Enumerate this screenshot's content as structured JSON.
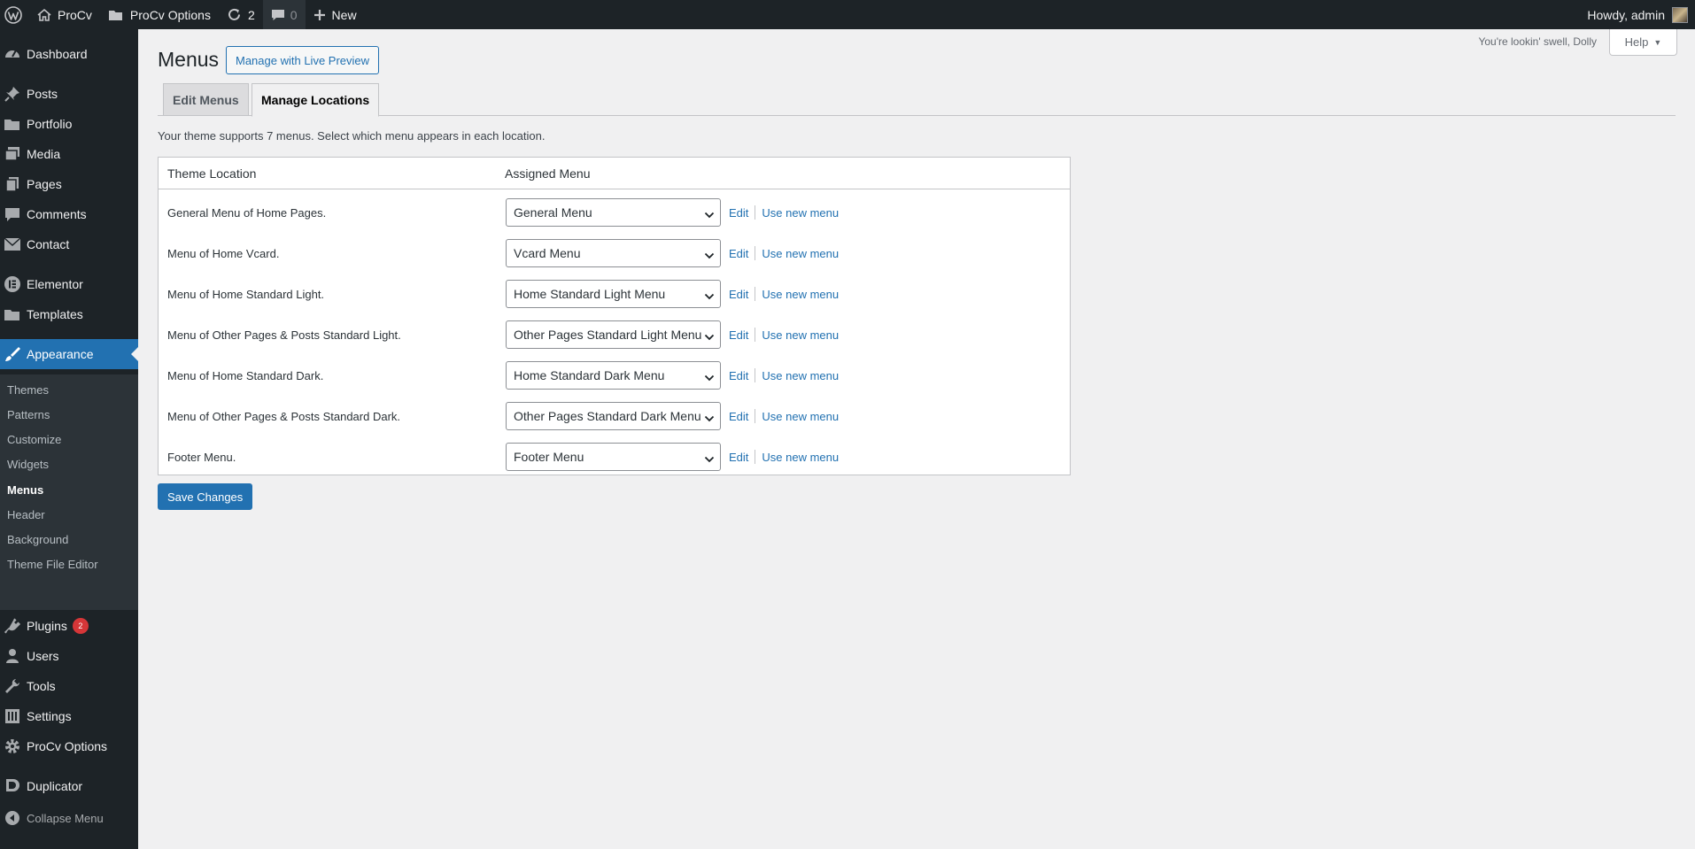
{
  "adminbar": {
    "site_name": "ProCv",
    "options_label": "ProCv Options",
    "updates_count": "2",
    "comments_count": "0",
    "new_label": "New",
    "howdy": "Howdy, admin"
  },
  "sidebar": {
    "items": [
      {
        "label": "Dashboard",
        "icon": "dashboard-icon"
      },
      {
        "label": "Posts",
        "icon": "pushpin-icon"
      },
      {
        "label": "Portfolio",
        "icon": "folder-icon"
      },
      {
        "label": "Media",
        "icon": "media-icon"
      },
      {
        "label": "Pages",
        "icon": "page-icon"
      },
      {
        "label": "Comments",
        "icon": "comment-icon"
      },
      {
        "label": "Contact",
        "icon": "mail-icon"
      },
      {
        "label": "Elementor",
        "icon": "elementor-icon"
      },
      {
        "label": "Templates",
        "icon": "folder-icon"
      },
      {
        "label": "Appearance",
        "icon": "paintbrush-icon"
      },
      {
        "label": "Plugins",
        "icon": "plugin-icon",
        "badge": "2"
      },
      {
        "label": "Users",
        "icon": "user-icon"
      },
      {
        "label": "Tools",
        "icon": "wrench-icon"
      },
      {
        "label": "Settings",
        "icon": "settings-icon"
      },
      {
        "label": "ProCv Options",
        "icon": "gear-icon"
      },
      {
        "label": "Duplicator",
        "icon": "duplicator-icon"
      }
    ],
    "submenu": [
      "Themes",
      "Patterns",
      "Customize",
      "Widgets",
      "Menus",
      "Header",
      "Background",
      "Theme File Editor"
    ],
    "collapse_label": "Collapse Menu"
  },
  "header": {
    "dolly": "You're lookin' swell, Dolly",
    "help_label": "Help"
  },
  "page": {
    "title": "Menus",
    "live_preview_label": "Manage with Live Preview",
    "tabs": [
      "Edit Menus",
      "Manage Locations"
    ],
    "intro": "Your theme supports 7 menus. Select which menu appears in each location.",
    "col_location": "Theme Location",
    "col_menu": "Assigned Menu",
    "edit_label": "Edit",
    "use_new_label": "Use new menu",
    "save_label": "Save Changes",
    "locations": [
      {
        "name": "General Menu of Home Pages.",
        "menu": "General Menu"
      },
      {
        "name": "Menu of Home Vcard.",
        "menu": "Vcard Menu"
      },
      {
        "name": "Menu of Home Standard Light.",
        "menu": "Home Standard Light Menu"
      },
      {
        "name": "Menu of Other Pages & Posts Standard Light.",
        "menu": "Other Pages Standard Light Menu"
      },
      {
        "name": "Menu of Home Standard Dark.",
        "menu": "Home Standard Dark Menu"
      },
      {
        "name": "Menu of Other Pages & Posts Standard Dark.",
        "menu": "Other Pages Standard Dark Menu"
      },
      {
        "name": "Footer Menu.",
        "menu": "Footer Menu"
      }
    ]
  },
  "colors": {
    "admin_dark": "#1d2327",
    "accent": "#2271b1",
    "badge": "#d63638"
  }
}
